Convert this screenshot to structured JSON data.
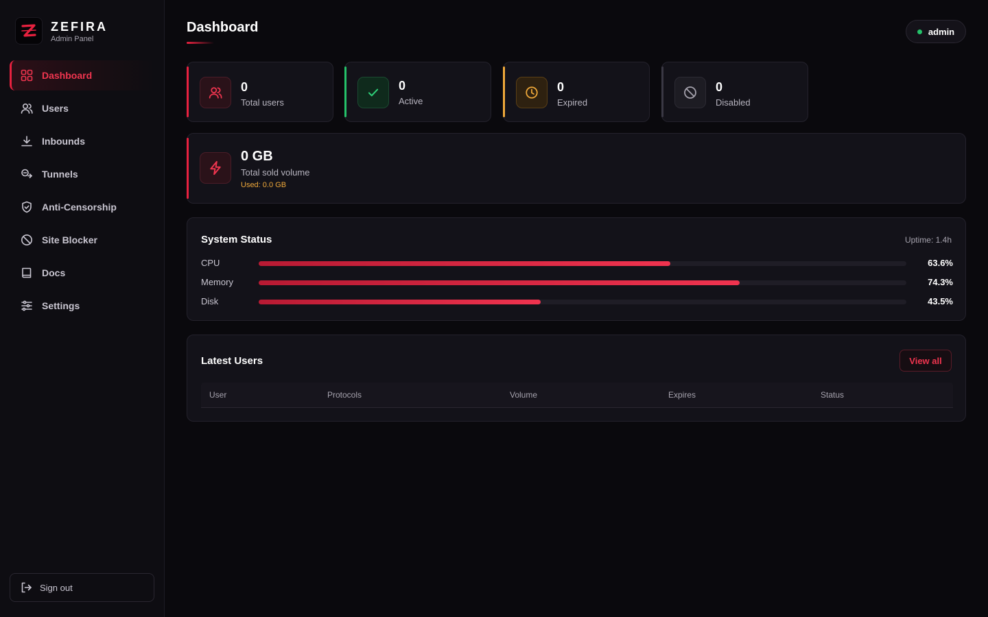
{
  "brand": {
    "name": "ZEFIRA",
    "subtitle": "Admin Panel"
  },
  "sidebar": {
    "items": [
      {
        "label": "Dashboard",
        "icon": "grid-icon",
        "active": true
      },
      {
        "label": "Users",
        "icon": "users-icon"
      },
      {
        "label": "Inbounds",
        "icon": "download-icon"
      },
      {
        "label": "Tunnels",
        "icon": "tunnel-icon"
      },
      {
        "label": "Anti-Censorship",
        "icon": "shield-icon"
      },
      {
        "label": "Site Blocker",
        "icon": "block-icon"
      },
      {
        "label": "Docs",
        "icon": "book-icon"
      },
      {
        "label": "Settings",
        "icon": "sliders-icon"
      }
    ],
    "signout_label": "Sign out"
  },
  "header": {
    "title": "Dashboard",
    "user": "admin"
  },
  "stats": [
    {
      "value": "0",
      "label": "Total users",
      "color": "#e8213f"
    },
    {
      "value": "0",
      "label": "Active",
      "color": "#25c26a"
    },
    {
      "value": "0",
      "label": "Expired",
      "color": "#f0a93a"
    },
    {
      "value": "0",
      "label": "Disabled",
      "color": "#3a3844"
    }
  ],
  "volume": {
    "value": "0 GB",
    "label": "Total sold volume",
    "used": "Used: 0.0 GB"
  },
  "system_status": {
    "title": "System Status",
    "uptime": "Uptime: 1.4h",
    "metrics": [
      {
        "label": "CPU",
        "percent": 63.6,
        "display": "63.6%"
      },
      {
        "label": "Memory",
        "percent": 74.3,
        "display": "74.3%"
      },
      {
        "label": "Disk",
        "percent": 43.5,
        "display": "43.5%"
      }
    ]
  },
  "latest_users": {
    "title": "Latest Users",
    "view_all": "View all",
    "columns": [
      "User",
      "Protocols",
      "Volume",
      "Expires",
      "Status"
    ]
  },
  "colors": {
    "accent": "#e8213f",
    "success": "#25c26a",
    "warning": "#f0a93a",
    "background": "#0a090d"
  }
}
